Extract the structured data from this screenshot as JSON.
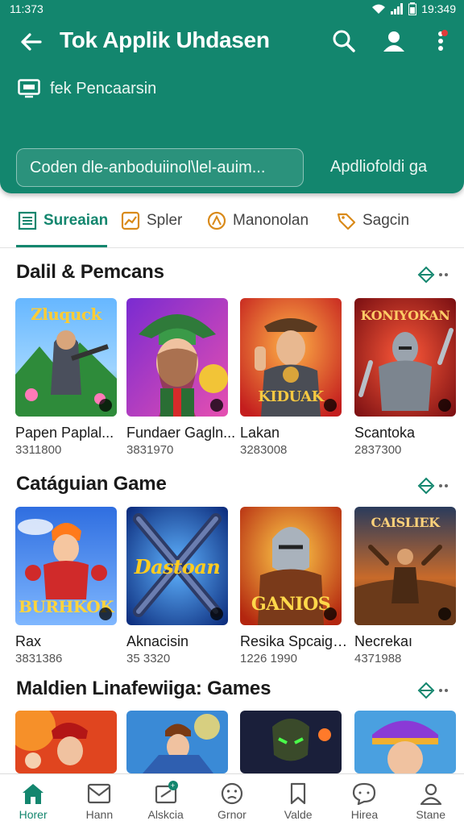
{
  "status_bar": {
    "time_left": "11:373",
    "time_right": "19:349"
  },
  "header": {
    "title": "Tok Applik Uhdasen",
    "subtitle": "fek Pencaarsin",
    "search_value": "Coden dle-anboduiinol\\lel-auim...",
    "side_link": "Apdliofoldi ga",
    "icons": [
      "back-arrow-icon",
      "search-icon",
      "profile-icon",
      "more-vert-icon"
    ],
    "accent": "#13866e"
  },
  "tabs": [
    {
      "label": "Sureaian",
      "icon": "list-icon",
      "active": true
    },
    {
      "label": "Spler",
      "icon": "chart-icon",
      "active": false
    },
    {
      "label": "Manonolan",
      "icon": "compass-icon",
      "active": false
    },
    {
      "label": "Sagcin",
      "icon": "tag-icon",
      "active": false
    }
  ],
  "sections": [
    {
      "title": "Dalil & Pemcans",
      "items": [
        {
          "name": "Papen Paplal...",
          "count": "3311800",
          "art": "Zluquck"
        },
        {
          "name": "Fundaer Gagln...",
          "count": "3831970",
          "art": ""
        },
        {
          "name": "Lakan",
          "count": "3283008",
          "art": "KIDUAK"
        },
        {
          "name": "Scantoka",
          "count": "2837300",
          "art": "KONIYOKAN"
        }
      ]
    },
    {
      "title": "Catáguian Game",
      "items": [
        {
          "name": "Rax",
          "count": "3831386",
          "art": "BURHKOK"
        },
        {
          "name": "Aknacisin",
          "count": "35 3320",
          "art": "Dastoan"
        },
        {
          "name": "Resika Spcaigh...",
          "count": "1226 1990",
          "art": "GANIOS"
        },
        {
          "name": "Necrekaı",
          "count": "4371988",
          "art": "CAISLIEK"
        }
      ]
    },
    {
      "title": "Maldien Linafewiiga: Games",
      "items": [
        {
          "name": "",
          "count": "",
          "art": ""
        },
        {
          "name": "",
          "count": "",
          "art": ""
        },
        {
          "name": "",
          "count": "",
          "art": ""
        },
        {
          "name": "",
          "count": "",
          "art": ""
        }
      ]
    }
  ],
  "bottom_nav": [
    {
      "label": "Horer",
      "icon": "home-icon",
      "active": true
    },
    {
      "label": "Hann",
      "icon": "mail-icon",
      "active": false
    },
    {
      "label": "Alskcia",
      "icon": "wallet-icon",
      "active": false,
      "badge": "+"
    },
    {
      "label": "Grnor",
      "icon": "face-icon",
      "active": false
    },
    {
      "label": "Valde",
      "icon": "bookmark-icon",
      "active": false
    },
    {
      "label": "Hirea",
      "icon": "chat-icon",
      "active": false
    },
    {
      "label": "Stane",
      "icon": "user-icon",
      "active": false
    }
  ]
}
